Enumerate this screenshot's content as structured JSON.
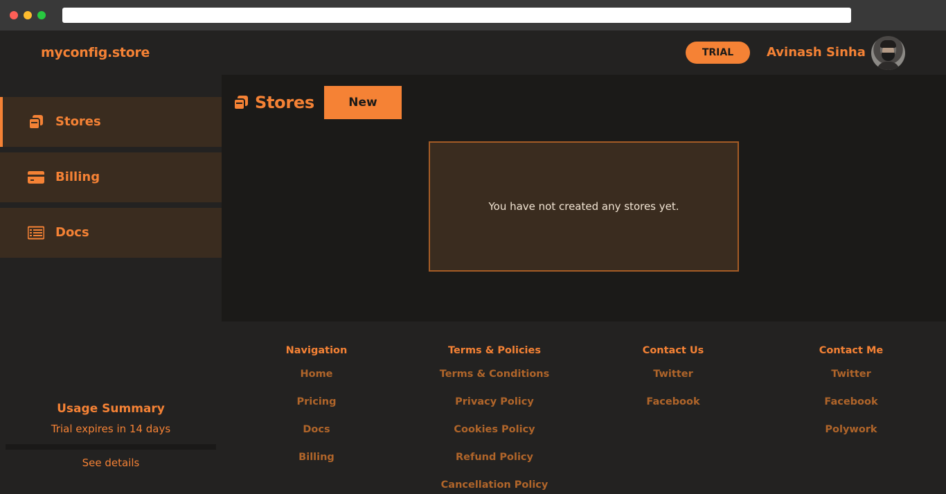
{
  "header": {
    "brand": "myconfig.store",
    "badge": "TRIAL",
    "user_name": "Avinash Sinha"
  },
  "colors": {
    "accent": "#f58235",
    "background": "#232221",
    "main_background": "#1b1a18",
    "card_background": "#3a2c1f"
  },
  "sidebar": {
    "items": [
      {
        "label": "Stores",
        "icon": "stores-icon",
        "active": true
      },
      {
        "label": "Billing",
        "icon": "credit-card-icon",
        "active": false
      },
      {
        "label": "Docs",
        "icon": "docs-icon",
        "active": false
      }
    ],
    "usage": {
      "title": "Usage Summary",
      "subtitle": "Trial expires in 14 days",
      "progress_fraction": 0,
      "link": "See details"
    }
  },
  "main": {
    "title": "Stores",
    "new_button": "New",
    "empty_message": "You have not created any stores yet."
  },
  "footer": {
    "columns": [
      {
        "heading": "Navigation",
        "links": [
          "Home",
          "Pricing",
          "Docs",
          "Billing"
        ]
      },
      {
        "heading": "Terms & Policies",
        "links": [
          "Terms & Conditions",
          "Privacy Policy",
          "Cookies Policy",
          "Refund Policy",
          "Cancellation Policy"
        ]
      },
      {
        "heading": "Contact Us",
        "links": [
          "Twitter",
          "Facebook"
        ]
      },
      {
        "heading": "Contact Me",
        "links": [
          "Twitter",
          "Facebook",
          "Polywork"
        ]
      }
    ]
  }
}
